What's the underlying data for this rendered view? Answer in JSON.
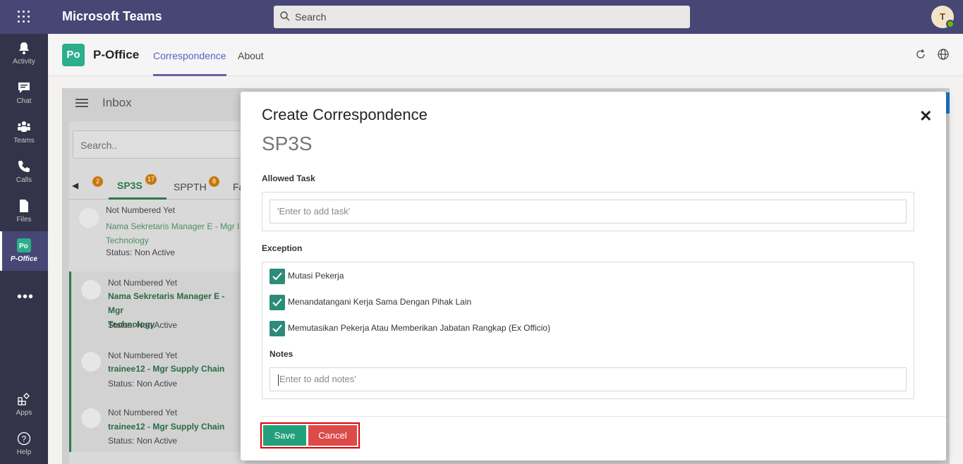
{
  "teams": {
    "title": "Microsoft Teams",
    "search_placeholder": "Search",
    "user_initial": "T",
    "rail": [
      {
        "label": "Activity",
        "icon": "bell-icon"
      },
      {
        "label": "Chat",
        "icon": "chat-icon"
      },
      {
        "label": "Teams",
        "icon": "teams-icon"
      },
      {
        "label": "Calls",
        "icon": "phone-icon"
      },
      {
        "label": "Files",
        "icon": "file-icon"
      },
      {
        "label": "P-Office",
        "icon": "poffice-icon"
      },
      {
        "label": "Apps",
        "icon": "apps-icon"
      },
      {
        "label": "Help",
        "icon": "help-icon"
      }
    ],
    "more": "•••"
  },
  "app": {
    "logo_text": "Po",
    "name": "P-Office",
    "tabs": [
      "Correspondence",
      "About"
    ]
  },
  "inbox": {
    "title": "Inbox",
    "search_placeholder": "Search..",
    "tabs": [
      {
        "label": "",
        "badge": "2"
      },
      {
        "label": "SP3S",
        "badge": "17"
      },
      {
        "label": "SPPTH",
        "badge": "8"
      },
      {
        "label": "Fa",
        "badge": ""
      }
    ],
    "items": [
      {
        "number": "Not Numbered Yet",
        "title": "Nama Sekretaris Manager E - Mgr I",
        "title2": "Technology",
        "status": "Status: Non Active"
      },
      {
        "number": "Not Numbered Yet",
        "title": "Nama Sekretaris Manager E - Mgr",
        "title2": "Technology",
        "status": "Status: Non Active"
      },
      {
        "number": "Not Numbered Yet",
        "title": "trainee12 - Mgr Supply Chain",
        "title2": "",
        "status": "Status: Non Active"
      },
      {
        "number": "Not Numbered Yet",
        "title": "trainee12 - Mgr Supply Chain",
        "title2": "",
        "status": "Status: Non Active"
      }
    ]
  },
  "modal": {
    "title": "Create Correspondence",
    "subtitle": "SP3S",
    "close": "✕",
    "allowed_task_label": "Allowed Task",
    "task_placeholder": "'Enter to add task'",
    "exception_label": "Exception",
    "exceptions": [
      "Mutasi Pekerja",
      "Menandatangani Kerja Sama Dengan Pihak Lain",
      "Memutasikan Pekerja Atau Memberikan Jabatan Rangkap (Ex Officio)"
    ],
    "notes_label": "Notes",
    "notes_placeholder": "Enter to add notes'",
    "save_label": "Save",
    "cancel_label": "Cancel"
  },
  "colors": {
    "teams_header": "#464775",
    "rail": "#33344a",
    "accent": "#6264a7",
    "save": "#22a07c",
    "cancel": "#dc4a4a",
    "check": "#2b8c7a"
  }
}
